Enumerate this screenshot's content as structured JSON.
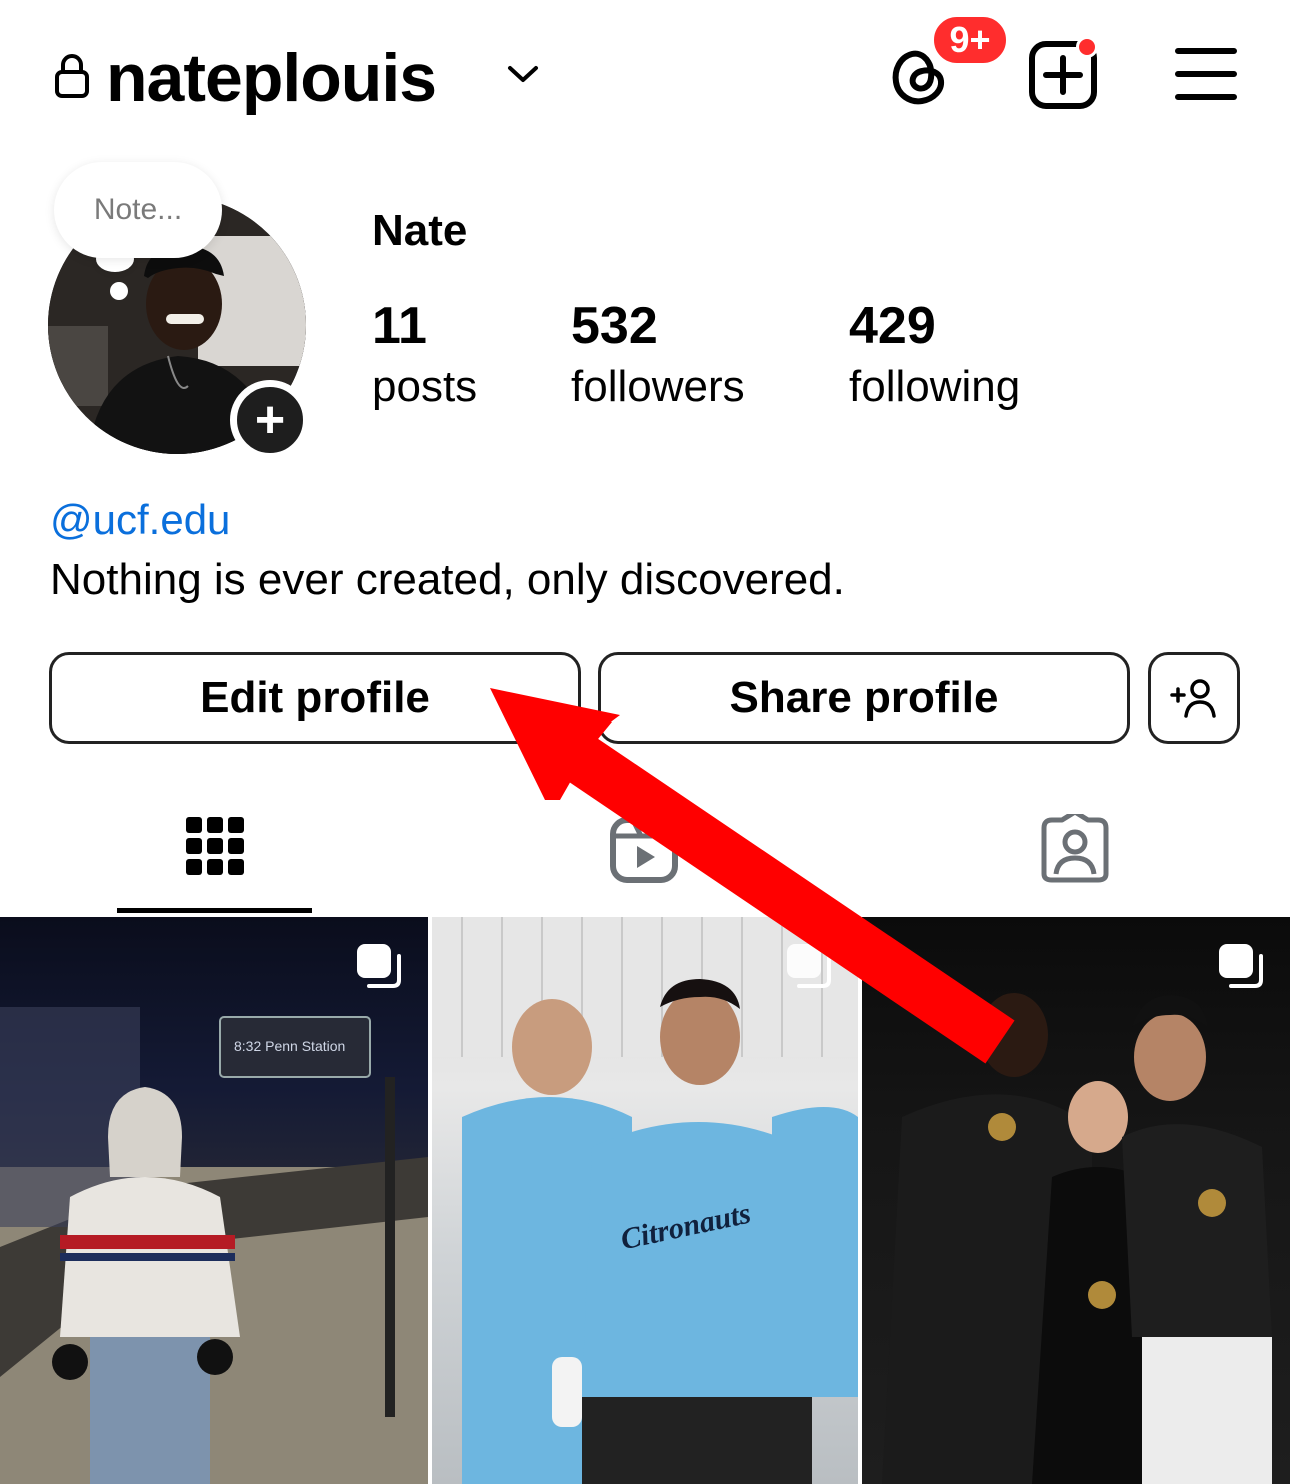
{
  "header": {
    "username": "nateplouis",
    "threads_badge": "9+",
    "icons": [
      "lock-icon",
      "chevron-down-icon",
      "threads-icon",
      "create-post-icon",
      "menu-icon"
    ]
  },
  "profile": {
    "note_placeholder": "Note...",
    "display_name": "Nate",
    "stats": {
      "posts_count": "11",
      "posts_label": "posts",
      "followers_count": "532",
      "followers_label": "followers",
      "following_count": "429",
      "following_label": "following"
    },
    "link": "@ucf.edu",
    "bio": "Nothing is ever created, only discovered."
  },
  "actions": {
    "edit_label": "Edit profile",
    "share_label": "Share profile"
  },
  "tabs": [
    {
      "icon": "grid-icon",
      "selected": true
    },
    {
      "icon": "reels-icon",
      "selected": false
    },
    {
      "icon": "tagged-icon",
      "selected": false
    }
  ],
  "grid": {
    "posts": [
      {
        "name": "post-train-station",
        "multi": true,
        "sign_text": "8:32 Penn Station"
      },
      {
        "name": "post-citronauts-team",
        "multi": true,
        "shirt_text": "Citronauts"
      },
      {
        "name": "post-award-night",
        "multi": true
      }
    ]
  },
  "colors": {
    "accent_link": "#0a6fdc",
    "badge_red": "#ff2d2d",
    "annotation_arrow": "#ff0000"
  }
}
